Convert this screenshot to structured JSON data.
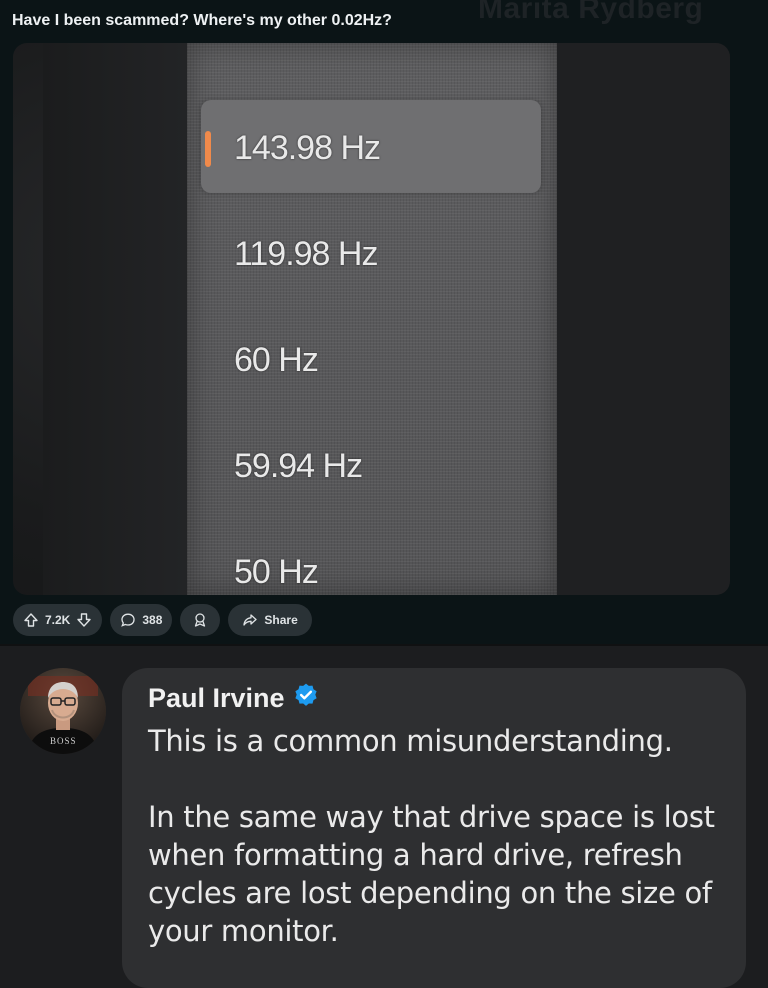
{
  "post": {
    "title": "Have I been scammed? Where's my other 0.02Hz?",
    "watermark": "Marita Rydberg",
    "refresh_rates": [
      {
        "label": "143.98 Hz",
        "selected": true
      },
      {
        "label": "119.98 Hz",
        "selected": false
      },
      {
        "label": "60 Hz",
        "selected": false
      },
      {
        "label": "59.94 Hz",
        "selected": false
      },
      {
        "label": "50 Hz",
        "selected": false
      }
    ],
    "actions": {
      "vote_count": "7.2K",
      "comment_count": "388",
      "share_label": "Share"
    }
  },
  "comment": {
    "author": "Paul Irvine",
    "verified": true,
    "avatar_text": "BOSS",
    "paragraphs": [
      "This is a common misunderstanding.",
      "In the same way that drive space is lost when formatting a hard drive, refresh cycles are lost depending on the size of your monitor."
    ]
  },
  "colors": {
    "post_bg": "#0b1416",
    "comment_bubble": "#2e2f31",
    "selection_accent": "#f08a4b",
    "verified_badge": "#1d9bf0"
  },
  "icons": [
    "upvote-icon",
    "downvote-icon",
    "comment-icon",
    "award-icon",
    "share-icon",
    "verified-badge-icon"
  ]
}
